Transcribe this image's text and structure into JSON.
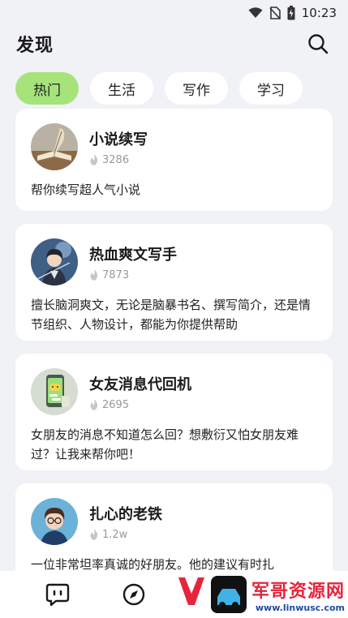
{
  "status_bar": {
    "time": "10:23"
  },
  "header": {
    "title": "发现"
  },
  "tabs": [
    {
      "label": "热门",
      "active": true
    },
    {
      "label": "生活",
      "active": false
    },
    {
      "label": "写作",
      "active": false
    },
    {
      "label": "学习",
      "active": false
    }
  ],
  "cards": [
    {
      "name": "小说续写",
      "heat": "3286",
      "desc": "帮你续写超人气小说",
      "avatar": "quill-book-avatar"
    },
    {
      "name": "热血爽文写手",
      "heat": "7873",
      "desc": "擅长脑洞爽文，无论是脑暴书名、撰写简介，还是情节组织、人物设计，都能为你提供帮助",
      "avatar": "swordsman-avatar"
    },
    {
      "name": "女友消息代回机",
      "heat": "2695",
      "desc": "女朋友的消息不知道怎么回？想敷衍又怕女朋友难过？让我来帮你吧！",
      "avatar": "phone-chat-avatar"
    },
    {
      "name": "扎心的老铁",
      "heat": "1.2w",
      "desc": "一位非常坦率真诚的好朋友。他的建议有时扎",
      "avatar": "boy-glasses-avatar"
    }
  ],
  "watermark": {
    "text": "军哥资源网",
    "url": "www.linwusc.com"
  }
}
